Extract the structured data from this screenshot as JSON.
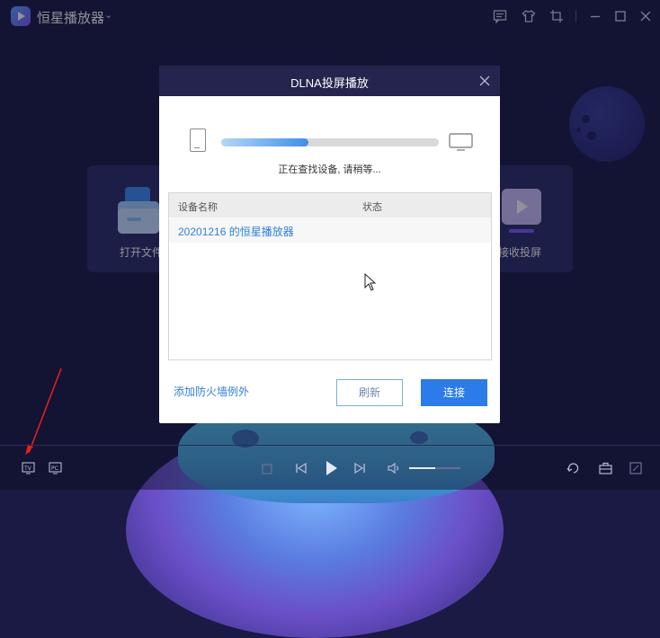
{
  "app": {
    "title": "恒星播放器"
  },
  "home": {
    "open_file_label": "打开文件",
    "receive_cast_label": "接收投屏"
  },
  "dialog": {
    "title": "DLNA投屏播放",
    "status_text": "正在查找设备, 请稍等...",
    "progress": 0.4,
    "columns": {
      "name": "设备名称",
      "status": "状态"
    },
    "devices": [
      {
        "name": "20201216 的恒星播放器",
        "status": ""
      }
    ],
    "firewall_link": "添加防火墙例外",
    "refresh_label": "刷新",
    "connect_label": "连接"
  },
  "player": {
    "volume": 0.5
  },
  "icons": {
    "titlebar": [
      "chat-icon",
      "skin-icon",
      "crop-icon",
      "minimize-icon",
      "maximize-icon",
      "close-icon"
    ],
    "bottom_left": [
      "tv-cast-icon",
      "pc-cast-icon"
    ],
    "transport": [
      "stop-icon",
      "previous-icon",
      "play-icon",
      "next-icon",
      "volume-icon"
    ],
    "bottom_right": [
      "loop-icon",
      "toolbox-icon",
      "fullscreen-icon"
    ]
  },
  "colors": {
    "accent": "#2b7be8",
    "background": "#1a1a44",
    "link": "#2f7fdc"
  }
}
